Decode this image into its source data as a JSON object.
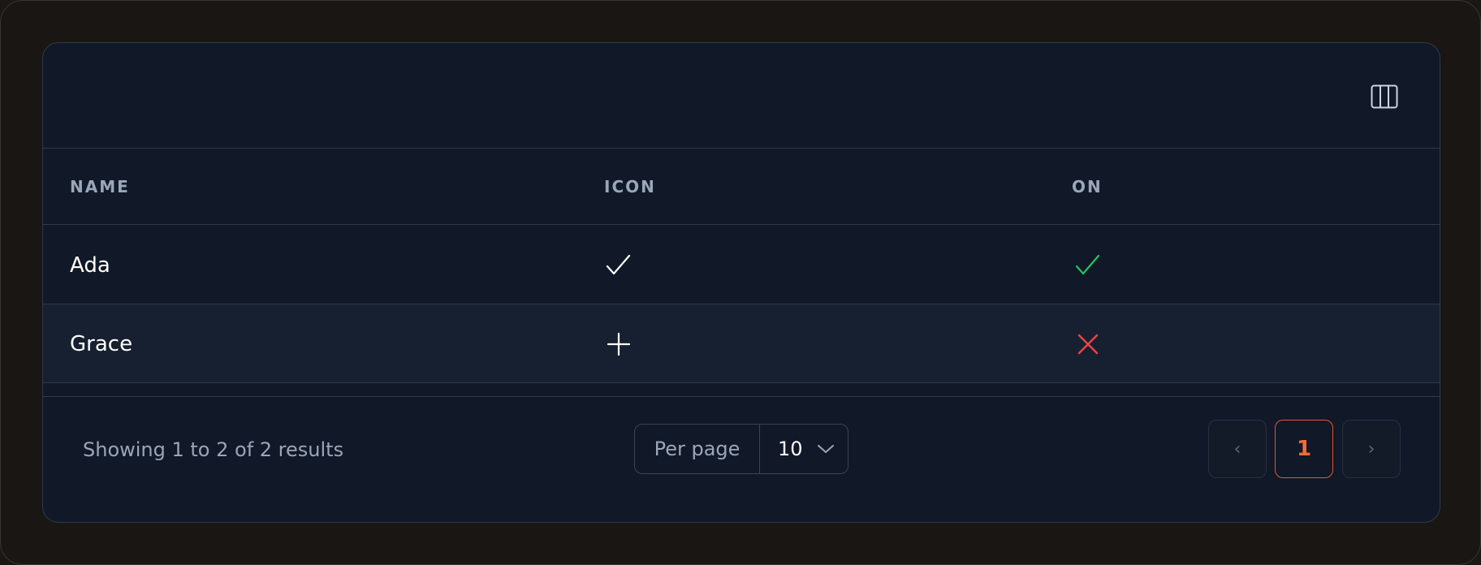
{
  "toolbar": {
    "columns_icon": "columns-icon"
  },
  "table": {
    "columns": [
      "NAME",
      "ICON",
      "ON"
    ],
    "rows": [
      {
        "name": "Ada",
        "icon": "check-icon",
        "on": true
      },
      {
        "name": "Grace",
        "icon": "plus-icon",
        "on": false
      }
    ]
  },
  "footer": {
    "summary": "Showing 1 to 2 of 2 results",
    "per_page_label": "Per page",
    "per_page_value": "10",
    "pagination": {
      "prev": "‹",
      "current": "1",
      "next": "›"
    }
  },
  "colors": {
    "accent": "#f26b3a",
    "on_true": "#22c55e",
    "on_false": "#ef4444"
  }
}
